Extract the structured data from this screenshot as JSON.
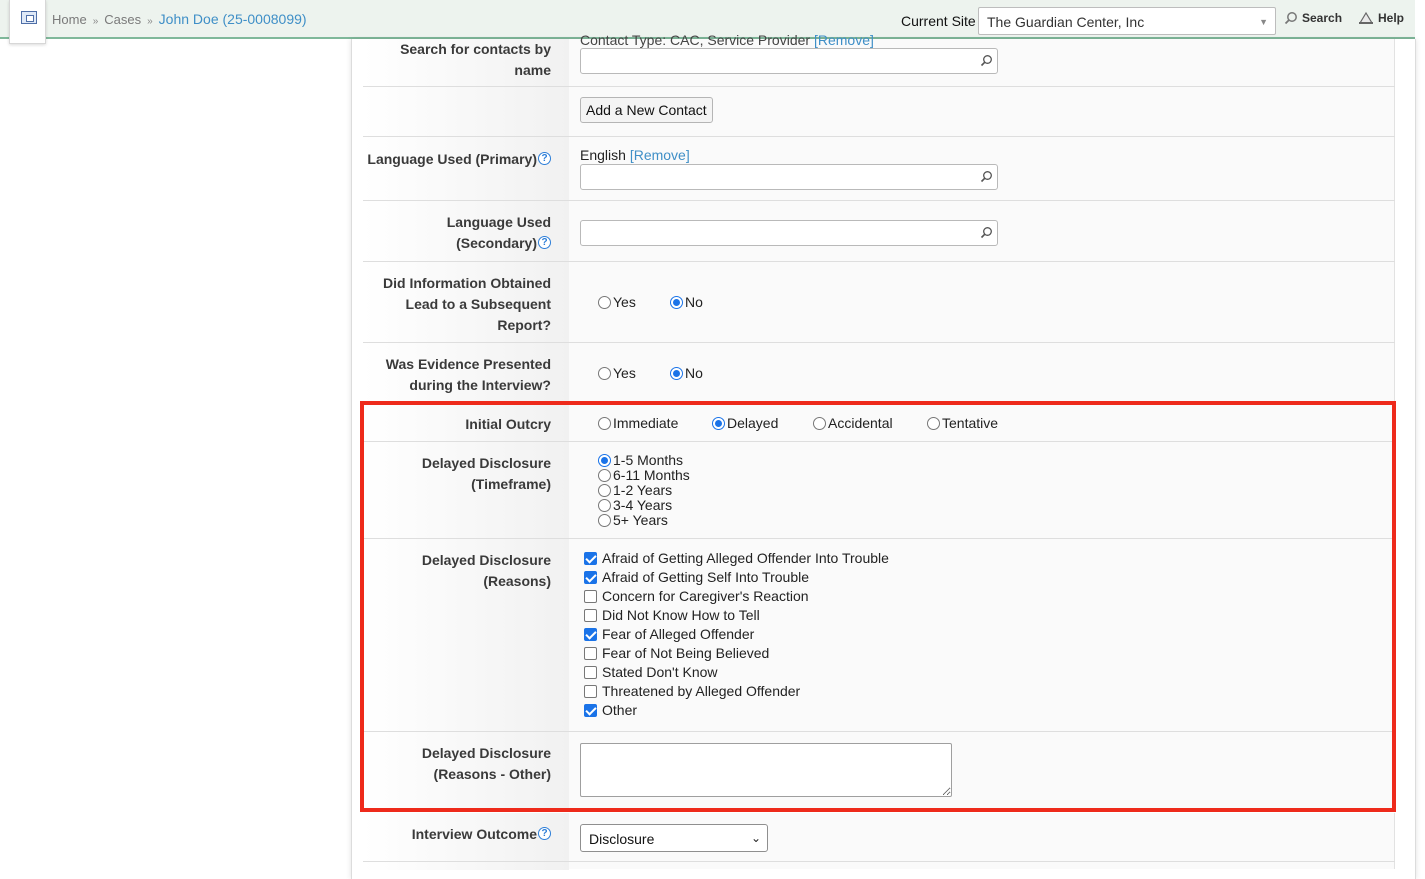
{
  "header": {
    "breadcrumb": {
      "home": "Home",
      "sep1": "»",
      "cases": "Cases",
      "sep2": "»",
      "current": "John Doe (25-0008099)"
    },
    "site_label": "Current Site",
    "site_value": "The Guardian Center, Inc",
    "search_label": "Search",
    "help_label": "Help",
    "icons": {
      "app": "app-icon",
      "search": "search-icon",
      "help": "help-icon"
    }
  },
  "contacts": {
    "partial_text": "Contact Type: CAC, Service Provider",
    "partial_remove": "[Remove]",
    "label": "Search for contacts by name",
    "add_button": "Add a New Contact"
  },
  "language_primary": {
    "label": "Language Used (Primary)",
    "value": "English",
    "remove": "[Remove]",
    "help": "?"
  },
  "language_secondary": {
    "label": "Language Used (Secondary)",
    "help": "?"
  },
  "subsequent_report": {
    "label": "Did Information Obtained Lead to a Subsequent Report?",
    "options": [
      "Yes",
      "No"
    ],
    "selected": "No"
  },
  "evidence_presented": {
    "label": "Was Evidence Presented during the Interview?",
    "options": [
      "Yes",
      "No"
    ],
    "selected": "No"
  },
  "initial_outcry": {
    "label": "Initial Outcry",
    "options": [
      "Immediate",
      "Delayed",
      "Accidental",
      "Tentative"
    ],
    "selected": "Delayed"
  },
  "delayed_timeframe": {
    "label": "Delayed Disclosure (Timeframe)",
    "options": [
      "1-5 Months",
      "6-11 Months",
      "1-2 Years",
      "3-4 Years",
      "5+ Years"
    ],
    "selected": "1-5 Months"
  },
  "delayed_reasons": {
    "label": "Delayed Disclosure (Reasons)",
    "items": [
      {
        "label": "Afraid of Getting Alleged Offender Into Trouble",
        "checked": true
      },
      {
        "label": "Afraid of Getting Self Into Trouble",
        "checked": true
      },
      {
        "label": "Concern for Caregiver's Reaction",
        "checked": false
      },
      {
        "label": "Did Not Know How to Tell",
        "checked": false
      },
      {
        "label": "Fear of Alleged Offender",
        "checked": true
      },
      {
        "label": "Fear of Not Being Believed",
        "checked": false
      },
      {
        "label": "Stated Don't Know",
        "checked": false
      },
      {
        "label": "Threatened by Alleged Offender",
        "checked": false
      },
      {
        "label": "Other",
        "checked": true
      }
    ]
  },
  "delayed_reasons_other": {
    "label": "Delayed Disclosure (Reasons - Other)",
    "value": ""
  },
  "interview_outcome": {
    "label": "Interview Outcome",
    "selected": "Disclosure",
    "help": "?"
  },
  "colors": {
    "accent": "#3f8fc7",
    "highlight": "#ee2a1b",
    "radio_checked": "#1a73e8"
  }
}
